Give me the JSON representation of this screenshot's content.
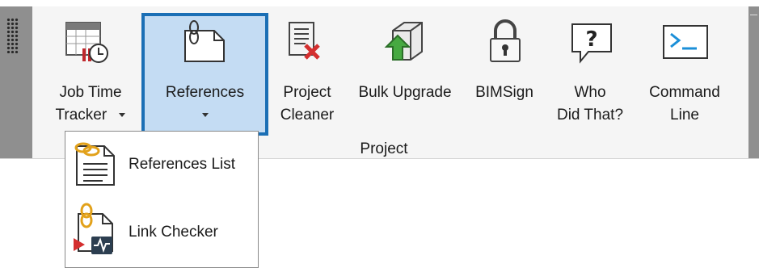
{
  "ribbon": {
    "panel_label": "Project",
    "tools": [
      {
        "line1": "Job Time",
        "line2": "Tracker",
        "icon": "job-time-tracker-icon"
      },
      {
        "line1": "References",
        "line2": "",
        "icon": "references-icon"
      },
      {
        "line1": "Project",
        "line2": "Cleaner",
        "icon": "project-cleaner-icon"
      },
      {
        "line1": "Bulk Upgrade",
        "line2": "",
        "icon": "bulk-upgrade-icon"
      },
      {
        "line1": "BIMSign",
        "line2": "",
        "icon": "lock-icon"
      },
      {
        "line1": "Who",
        "line2": "Did That?",
        "icon": "question-bubble-icon"
      },
      {
        "line1": "Command",
        "line2": "Line",
        "icon": "command-line-icon"
      }
    ]
  },
  "dropdown": {
    "items": [
      {
        "label": "References List",
        "icon": "references-list-icon"
      },
      {
        "label": "Link Checker",
        "icon": "link-checker-icon"
      }
    ]
  },
  "colors": {
    "selection_fill": "#c4dcf3",
    "selection_border": "#1b6fb5",
    "grip": "#8f8f8f",
    "ribbon_bg": "#f5f5f5"
  }
}
